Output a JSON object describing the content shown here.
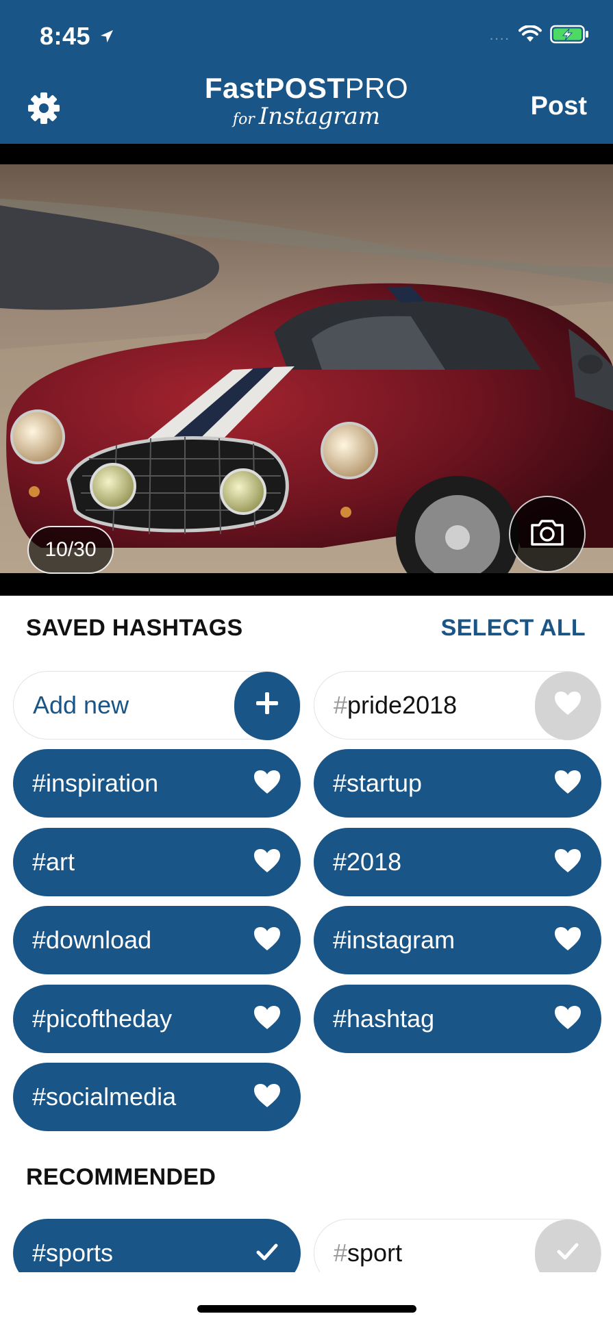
{
  "status_bar": {
    "time": "8:45",
    "signal": "....",
    "icons": [
      "location-arrow-icon",
      "wifi-icon",
      "battery-charging-icon"
    ]
  },
  "header": {
    "logo_fast": "Fast",
    "logo_post": "POST",
    "logo_pro": "PRO",
    "logo_for": "for",
    "logo_instagram": "Instagram",
    "post_label": "Post",
    "settings_icon": "gear-icon"
  },
  "photo": {
    "counter": "10/30",
    "camera_icon": "camera-icon"
  },
  "saved": {
    "title": "SAVED HASHTAGS",
    "select_all": "SELECT ALL",
    "add_new": "Add new",
    "pride": "pride2018",
    "hash": "#",
    "tags": {
      "inspiration": "#inspiration",
      "startup": "#startup",
      "art": "#art",
      "y2018": "#2018",
      "download": "#download",
      "instagram": "#instagram",
      "picoftheday": "#picoftheday",
      "hashtag": "#hashtag",
      "socialmedia": "#socialmedia"
    }
  },
  "recommended": {
    "title": "RECOMMENDED",
    "sports": "#sports",
    "sport": "sport",
    "hash": "#"
  },
  "colors": {
    "brand_blue": "#1a5587",
    "inactive_grey": "#d4d4d4",
    "battery_green": "#4cd964"
  }
}
